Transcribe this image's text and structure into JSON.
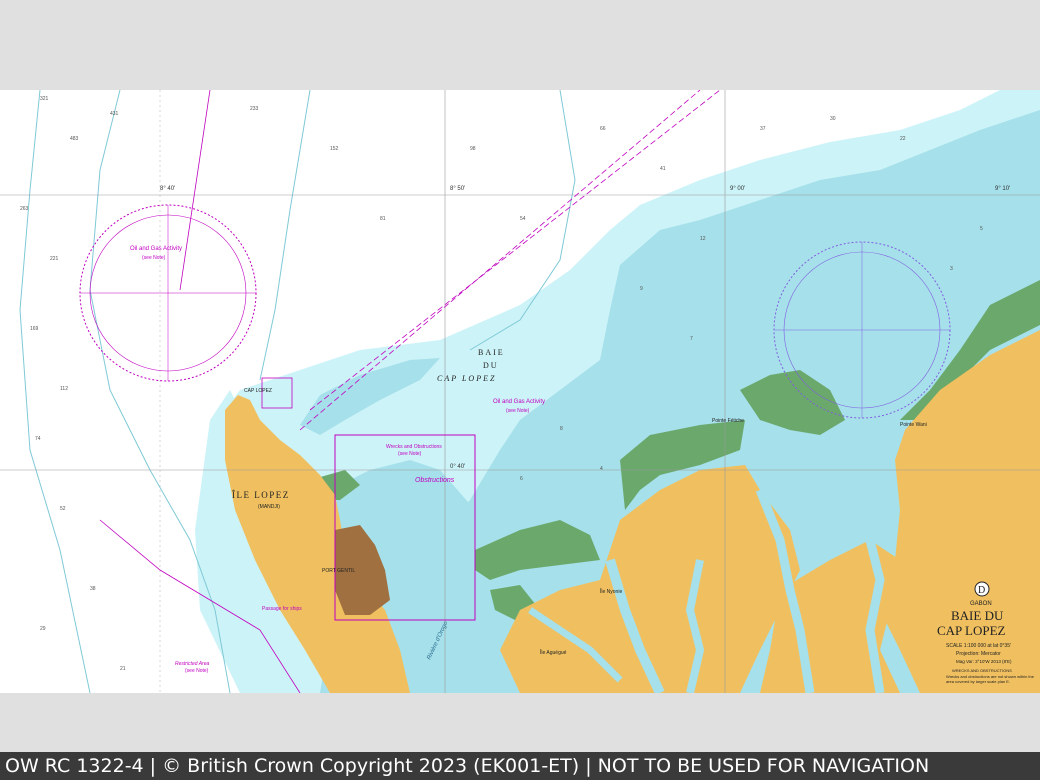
{
  "colors": {
    "background": "#e0e0e0",
    "deep_water": "#ffffff",
    "shallow_water": "#ccf3f8",
    "very_shallow_water": "#a6e0ea",
    "drying_area": "#6aa86c",
    "land": "#f0c060",
    "town": "#a07040",
    "magenta": "#c000c0",
    "footer_bg": "#3a3a3a"
  },
  "chart": {
    "chart_letter": "D",
    "country": "GABON",
    "title_line1": "BAIE DU",
    "title_line2": "CAP LOPEZ",
    "scale": "SCALE 1:100 000 at lat 0°35'",
    "projection": "Projection: Mercator",
    "mag_var": "Mag Var: 3°10'W 2013 (8'E)",
    "wrecks_heading": "WRECKS AND OBSTRUCTIONS",
    "wrecks_note": "Wrecks and obstructions are not shown within the area covered by larger scale plan E."
  },
  "labels": {
    "bay_line1": "BAIE",
    "bay_line2": "DU",
    "bay_line3": "CAP LOPEZ",
    "island": "ÎLE LOPEZ",
    "island_sub": "(MANDJI)",
    "port_gentil": "PORT GENTIL",
    "cap_lopez": "CAP LOPEZ",
    "oil_gas_1": "Oil and Gas Activity",
    "oil_gas_1_note": "(see Note)",
    "oil_gas_2": "Oil and Gas Activity",
    "oil_gas_2_note": "(see Note)",
    "wrecks_obs": "Wrecks and Obstructions",
    "wrecks_obs_note": "(see Note)",
    "obstructions": "Obstructions",
    "restricted": "Restricted Area",
    "restricted_note": "(see Note)",
    "passage": "Passage for ships",
    "pointe_fetiche": "Pointe Fétiche",
    "pointe_wani": "Pointe Wani",
    "ile_nyonie": "Île Nyonie",
    "riviere_orogo": "Rivière d'Orogo",
    "ile_aguegue": "Île Aguégué",
    "lon_1": "8° 40'",
    "lon_2": "8° 50'",
    "lon_3": "9° 00'",
    "lon_4": "9° 10'",
    "lat_1": "0° 40'"
  },
  "icons": {
    "compass_rose": "compass-rose-icon",
    "chart_letter_circle": "chart-letter-icon"
  },
  "footer": {
    "text": "OW RC 1322-4 | © British Crown Copyright 2023 (EK001-ET) | NOT TO BE USED FOR NAVIGATION"
  }
}
